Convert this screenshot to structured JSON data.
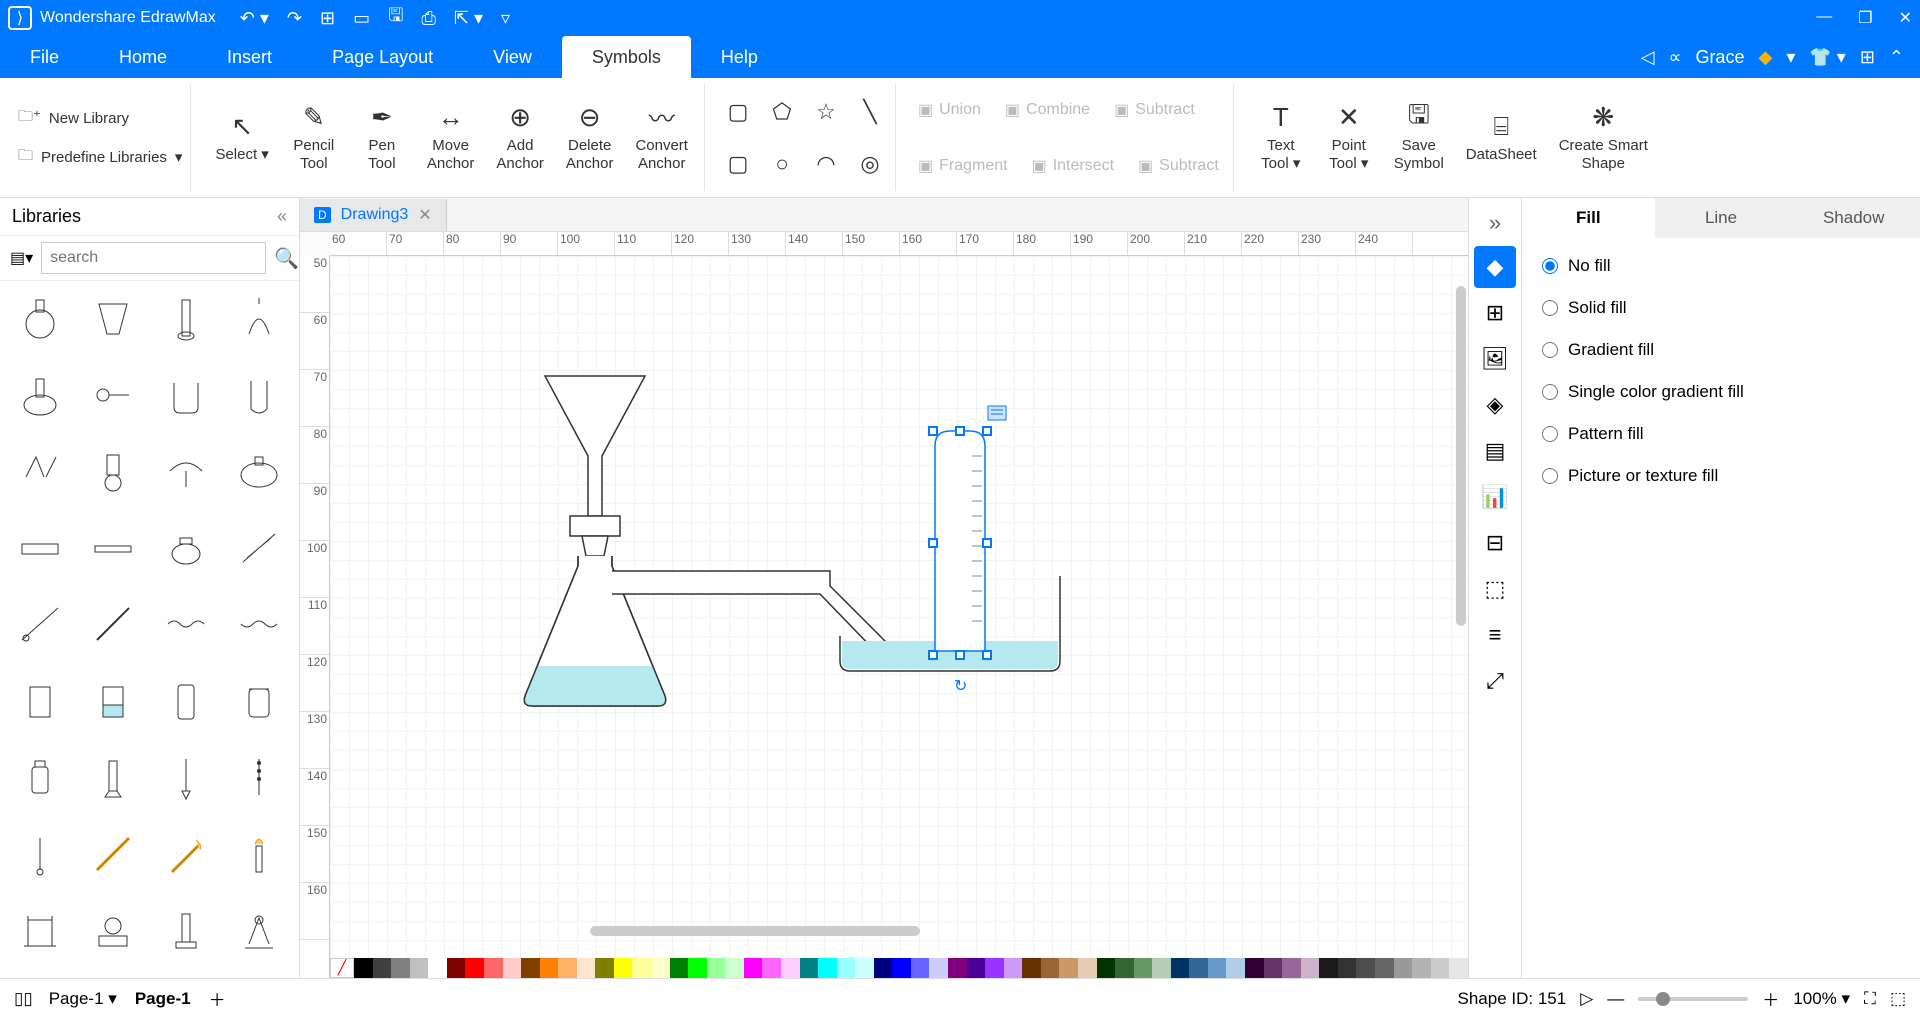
{
  "app": {
    "title": "Wondershare EdrawMax"
  },
  "menus": [
    "File",
    "Home",
    "Insert",
    "Page Layout",
    "View",
    "Symbols",
    "Help"
  ],
  "active_menu": 5,
  "user": "Grace",
  "ribbon": {
    "library": {
      "new": "New Library",
      "predefine": "Predefine Libraries"
    },
    "tools": [
      {
        "icon": "↖",
        "label": "Select"
      },
      {
        "icon": "✎",
        "label": "Pencil\nTool"
      },
      {
        "icon": "✒",
        "label": "Pen\nTool"
      },
      {
        "icon": "↔",
        "label": "Move\nAnchor"
      },
      {
        "icon": "⊕",
        "label": "Add\nAnchor"
      },
      {
        "icon": "⊖",
        "label": "Delete\nAnchor"
      },
      {
        "icon": "〰",
        "label": "Convert\nAnchor"
      }
    ],
    "bool_ops": [
      "Union",
      "Combine",
      "Subtract",
      "Fragment",
      "Intersect",
      "Subtract"
    ],
    "right_tools": [
      {
        "icon": "T",
        "label": "Text\nTool"
      },
      {
        "icon": "✕",
        "label": "Point\nTool"
      },
      {
        "icon": "🖫",
        "label": "Save\nSymbol"
      },
      {
        "icon": "⌸",
        "label": "DataSheet"
      },
      {
        "icon": "❋",
        "label": "Create Smart\nShape"
      }
    ]
  },
  "libraries_label": "Libraries",
  "search_placeholder": "search",
  "doc_tab": "Drawing3",
  "ruler_h": [
    "60",
    "70",
    "80",
    "90",
    "100",
    "110",
    "120",
    "130",
    "140",
    "150",
    "160",
    "170",
    "180",
    "190",
    "200",
    "210",
    "220",
    "230",
    "240"
  ],
  "ruler_v": [
    "50",
    "60",
    "70",
    "80",
    "90",
    "100",
    "110",
    "120",
    "130",
    "140",
    "150",
    "160"
  ],
  "props": {
    "tabs": [
      "Fill",
      "Line",
      "Shadow"
    ],
    "active_tab": 0,
    "options": [
      "No fill",
      "Solid fill",
      "Gradient fill",
      "Single color gradient fill",
      "Pattern fill",
      "Picture or texture fill"
    ],
    "selected": 0
  },
  "status": {
    "page_select": "Page-1",
    "page_tab": "Page-1",
    "shape_id": "Shape ID: 151",
    "zoom": "100%"
  },
  "colors": [
    "#000000",
    "#404040",
    "#808080",
    "#c0c0c0",
    "#ffffff",
    "#800000",
    "#ff0000",
    "#ff6666",
    "#ffcccc",
    "#804000",
    "#ff8000",
    "#ffb366",
    "#ffe6cc",
    "#808000",
    "#ffff00",
    "#ffff99",
    "#ffffcc",
    "#008000",
    "#00ff00",
    "#99ff99",
    "#ccffcc",
    "#ff00ff",
    "#ff66ff",
    "#ffccff",
    "#008080",
    "#00ffff",
    "#99ffff",
    "#ccffff",
    "#000080",
    "#0000ff",
    "#6666ff",
    "#ccccff",
    "#800080",
    "#4d0099",
    "#9933ff",
    "#cc99ff",
    "#663300",
    "#996633",
    "#cc9966",
    "#e6ccb3",
    "#003300",
    "#336633",
    "#669966",
    "#b3ccb3",
    "#003366",
    "#336699",
    "#6699cc",
    "#b3cce6",
    "#330033",
    "#663366",
    "#996699",
    "#ccb3cc",
    "#1a1a1a",
    "#333333",
    "#4d4d4d",
    "#666666",
    "#999999",
    "#b3b3b3",
    "#cccccc",
    "#e6e6e6"
  ]
}
